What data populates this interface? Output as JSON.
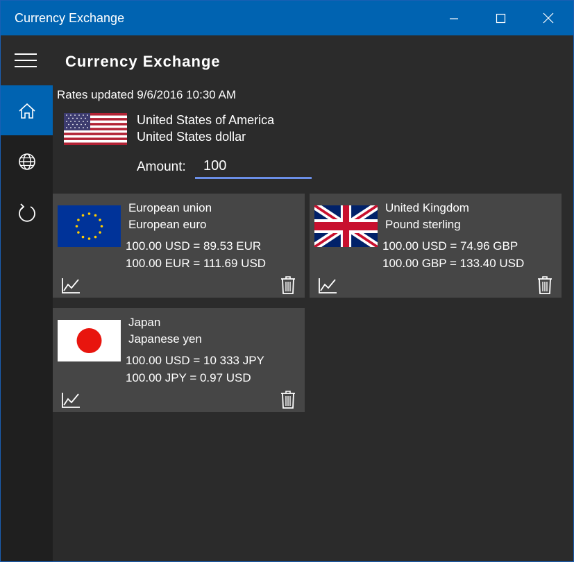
{
  "window": {
    "title": "Currency Exchange",
    "accent": "#0063b1"
  },
  "header": {
    "app_title": "Currency Exchange"
  },
  "sidebar": {
    "items": [
      {
        "icon": "home-icon",
        "selected": true
      },
      {
        "icon": "globe-icon",
        "selected": false
      },
      {
        "icon": "refresh-icon",
        "selected": false
      }
    ]
  },
  "main": {
    "rates_updated": "Rates updated 9/6/2016 10:30 AM",
    "base": {
      "flag": "us-flag",
      "country": "United States of America",
      "currency": "United States dollar"
    },
    "amount": {
      "label": "Amount:",
      "value": "100"
    },
    "cards": [
      {
        "flag": "eu-flag",
        "country": "European union",
        "currency": "European euro",
        "rate1": "100.00 USD = 89.53 EUR",
        "rate2": "100.00 EUR = 111.69 USD"
      },
      {
        "flag": "uk-flag",
        "country": "United Kingdom",
        "currency": "Pound sterling",
        "rate1": "100.00 USD = 74.96 GBP",
        "rate2": "100.00 GBP = 133.40 USD"
      },
      {
        "flag": "japan-flag",
        "country": "Japan",
        "currency": "Japanese yen",
        "rate1": "100.00 USD = 10 333 JPY",
        "rate2": "100.00 JPY = 0.97 USD"
      }
    ]
  }
}
